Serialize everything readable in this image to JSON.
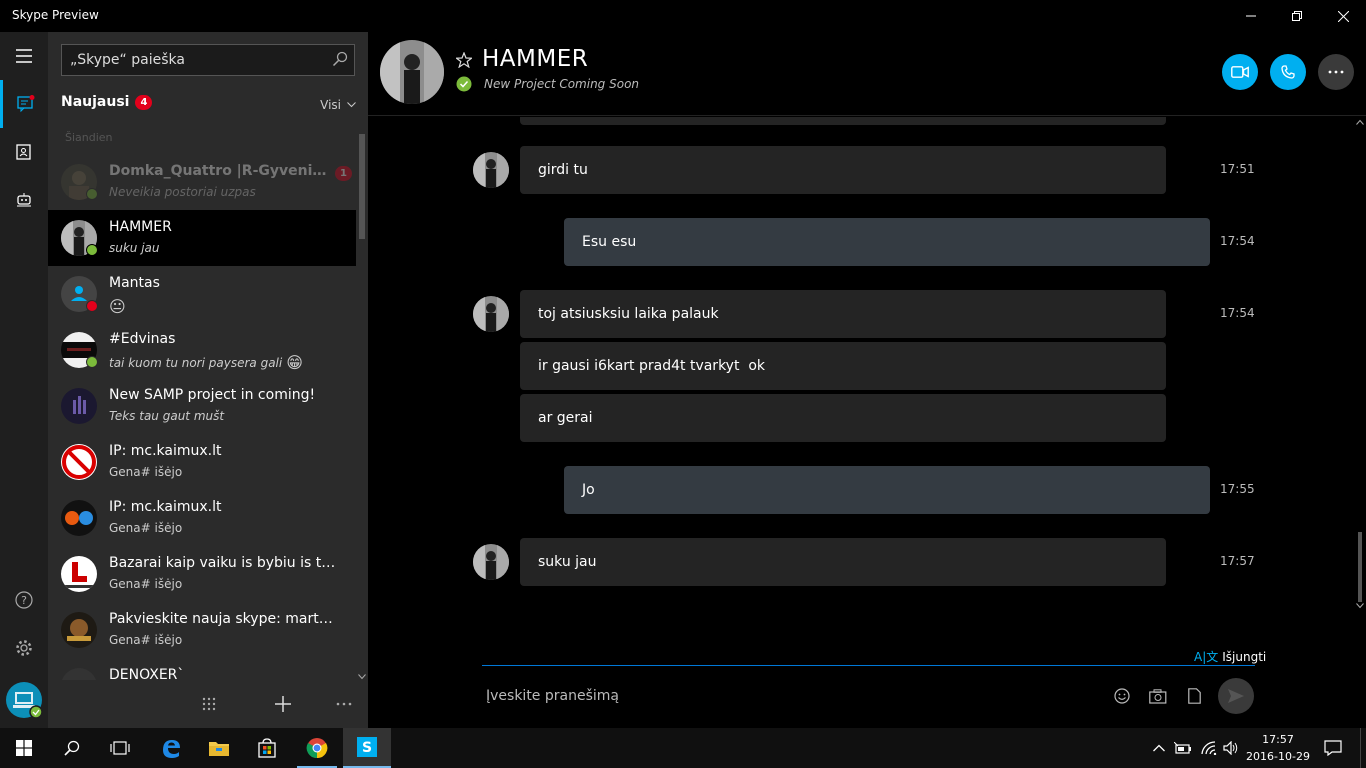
{
  "window": {
    "title": "Skype Preview"
  },
  "sidebar": {
    "search_placeholder": "„Skype“ paieška",
    "recent_label": "Naujausi",
    "recent_count": "4",
    "filter_label": "Visi",
    "section_today": "Šiandien",
    "conversations": [
      {
        "name": "Domka_Quattro |R-Gyvenim...",
        "preview": "Neveikia postoriai uzpas",
        "unread": "1",
        "status": "online"
      },
      {
        "name": "HAMMER",
        "preview": "suku jau",
        "status": "online"
      },
      {
        "name": "Mantas",
        "preview": "",
        "emoji": "😐",
        "status": "busy"
      },
      {
        "name": "#Edvinas",
        "preview": "tai kuom tu nori paysera gali",
        "emoji": "😁",
        "status": "online"
      },
      {
        "name": "New SAMP project in coming!",
        "preview": "Teks tau gaut mušt"
      },
      {
        "name": "IP: mc.kaimux.lt",
        "preview": "Gena# išėjo"
      },
      {
        "name": "IP: mc.kaimux.lt",
        "preview": "Gena# išėjo"
      },
      {
        "name": "Bazarai kaip vaiku is bybiu is tr...",
        "preview": "Gena# išėjo"
      },
      {
        "name": "Pakvieskite nauja skype: martyn...",
        "preview": "Gena# išėjo"
      },
      {
        "name": "DENOXER`",
        "preview": ""
      }
    ]
  },
  "chat": {
    "contact_name": "HAMMER",
    "contact_status": "New Project Coming Soon",
    "messages": [
      {
        "text": "girdi tu",
        "time": "17:51",
        "dir": "in"
      },
      {
        "text": "Esu esu",
        "time": "17:54",
        "dir": "out"
      },
      {
        "text": "toj atsiusksiu laika palauk",
        "time": "17:54",
        "dir": "in"
      },
      {
        "text": "ir gausi i6kart prad4t tvarkyt  ok",
        "time": "",
        "dir": "in"
      },
      {
        "text": "ar gerai",
        "time": "",
        "dir": "in"
      },
      {
        "text": "Jo",
        "time": "17:55",
        "dir": "out"
      },
      {
        "text": "suku jau",
        "time": "17:57",
        "dir": "in"
      }
    ],
    "translator_label": "Išjungti",
    "composer_placeholder": "Įveskite pranešimą"
  },
  "taskbar": {
    "time": "17:57",
    "date": "2016-10-29"
  },
  "colors": {
    "accent": "#00aff0",
    "online": "#7cbb3b",
    "busy": "#e3001b",
    "unread": "#e3001b"
  }
}
